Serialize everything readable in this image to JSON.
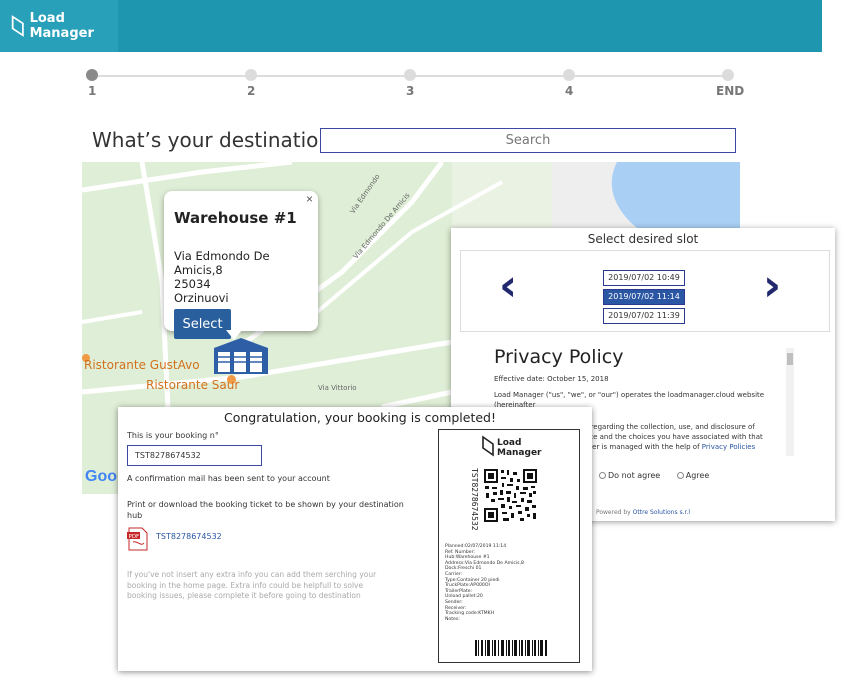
{
  "header": {
    "logo_text": "Load Manager",
    "bg_color": "#1f96b0"
  },
  "stepper": {
    "steps": [
      "1",
      "2",
      "3",
      "4",
      "END"
    ],
    "active_index": 0
  },
  "destination": {
    "title": "What’s your destination?",
    "search_placeholder": "Search"
  },
  "map": {
    "place_labels": [
      "Ristorante GustAvo",
      "Ristorante Saur"
    ],
    "road_labels": [
      "Via Edmondo De Amicis",
      "Via Edmondo",
      "Via Vittorio"
    ],
    "popup": {
      "title": "Warehouse #1",
      "address_line1": "Via Edmondo De Amicis,8",
      "address_line2": "25034",
      "address_line3": "Orzinuovi",
      "select_label": "Select",
      "close_glyph": "×"
    },
    "google_fragment": "Goo"
  },
  "slots": {
    "title": "Select desired slot",
    "items": [
      "2019/07/02 10:49",
      "2019/07/02 11:14",
      "2019/07/02 11:39"
    ],
    "selected_index": 1
  },
  "privacy": {
    "title": "Privacy Policy",
    "effective_date": "Effective date: October 15, 2018",
    "line1": "Load Manager (\"us\", \"we\", or \"our\") operates the loadmanager.cloud website (hereinafter",
    "line2": "policies regarding the collection, use, and disclosure of",
    "line3": "ur Service and the choices you have associated with that",
    "line4": "d Manager is managed with the help of",
    "link": "Privacy Policies",
    "disagree_label": "Do not agree",
    "agree_label": "Agree",
    "powered_prefix": "Powered by",
    "powered_company": "Ottre Solutions s.r.l"
  },
  "booking": {
    "title": "Congratulation, your booking is completed!",
    "number_label": "This is your booking n°",
    "booking_number": "TST8278674532",
    "mail_note": "A confirmation mail has been sent to your account",
    "print_note_line1": "Print or download the booking ticket to be shown by your destination",
    "print_note_line2": "hub",
    "pdf_link": "TST8278674532",
    "extra_line1": "If you've not insert any extra info you can add them serching your",
    "extra_line2": "booking in the home page. Extra info could be helpfull to solve",
    "extra_line3": "booking issues, please complete it before going to destination"
  },
  "ticket": {
    "logo_line1": "Load",
    "logo_line2": "Manager",
    "code": "TST8278674532",
    "info_lines": [
      "Planned:02/07/2019 11:14",
      "Ref. Number:",
      "Hub:Warehouse #1",
      "Address:Via Edmondo De Amicis,8",
      "Dock:Freschi 01",
      "Carrier:",
      "Type:Container 20 piedi",
      "TruckPlate:AP000OI",
      "TrailerPlate:",
      "Unload pallet:20",
      "Sender:",
      "Receiver:",
      "Tracking code:KTMKH",
      "Notes:"
    ]
  }
}
